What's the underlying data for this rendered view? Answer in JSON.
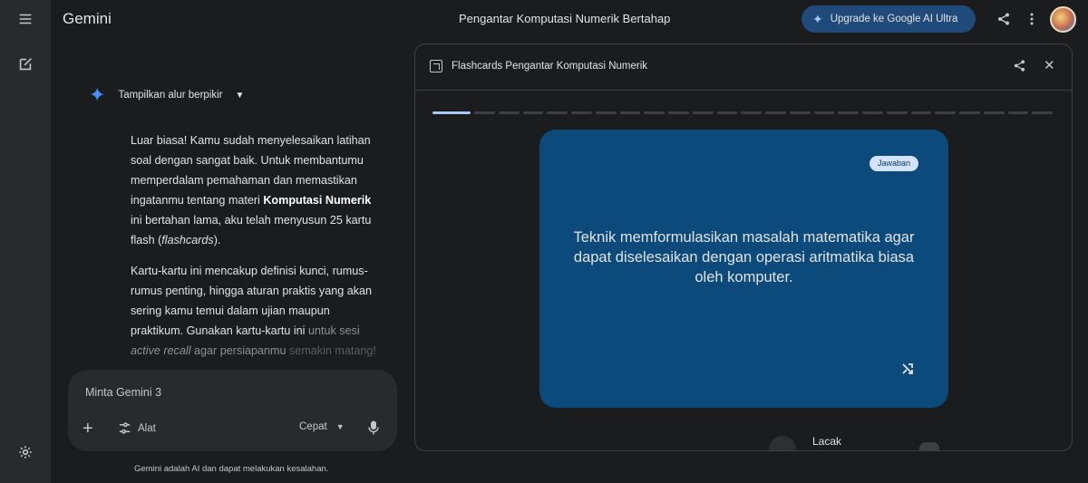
{
  "app": {
    "brand": "Gemini",
    "conversation_title": "Pengantar Komputasi Numerik Bertahap"
  },
  "header": {
    "upgrade_label": "Upgrade ke Google AI Ultra"
  },
  "sidebar": {
    "icons": [
      "menu-icon",
      "new-chat-icon",
      "settings-icon"
    ]
  },
  "chat": {
    "thinking_label": "Tampilkan alur berpikir",
    "para1": {
      "pre": "Luar biasa! Kamu sudah menyelesaikan latihan soal dengan sangat baik. Untuk membantumu memperdalam pemahaman dan memastikan ingatanmu tentang materi ",
      "bold": "Komputasi Numerik",
      "mid": " ini bertahan lama, aku telah menyusun 25 kartu flash (",
      "italic": "flashcards",
      "post": ")."
    },
    "para2": {
      "pre": "Kartu-kartu ini mencakup definisi kunci, rumus-rumus penting, hingga aturan praktis yang akan sering kamu temui dalam ujian maupun praktikum. Gunakan kartu-kartu ini ",
      "fade1": "untuk sesi ",
      "italic": "active recall",
      "fade2": " agar persiapanmu",
      "fade3": "semakin matang!"
    }
  },
  "composer": {
    "placeholder": "Minta Gemini 3",
    "tools_label": "Alat",
    "mode_label": "Cepat"
  },
  "disclaimer": "Gemini adalah AI dan dapat melakukan kesalahan.",
  "flashcards": {
    "panel_title": "Flashcards Pengantar Komputasi Numerik",
    "total_cards": 25,
    "current_card": 1,
    "badge": "Jawaban",
    "card_text": "Teknik memformulasikan masalah matematika agar dapat diselesaikan dengan operasi aritmatika biasa oleh komputer.",
    "track_label": "Lacak",
    "colors": {
      "card_bg": "#0b4a7a",
      "progress_active": "#a8c7fa",
      "badge_bg": "#d3e3fd"
    }
  }
}
